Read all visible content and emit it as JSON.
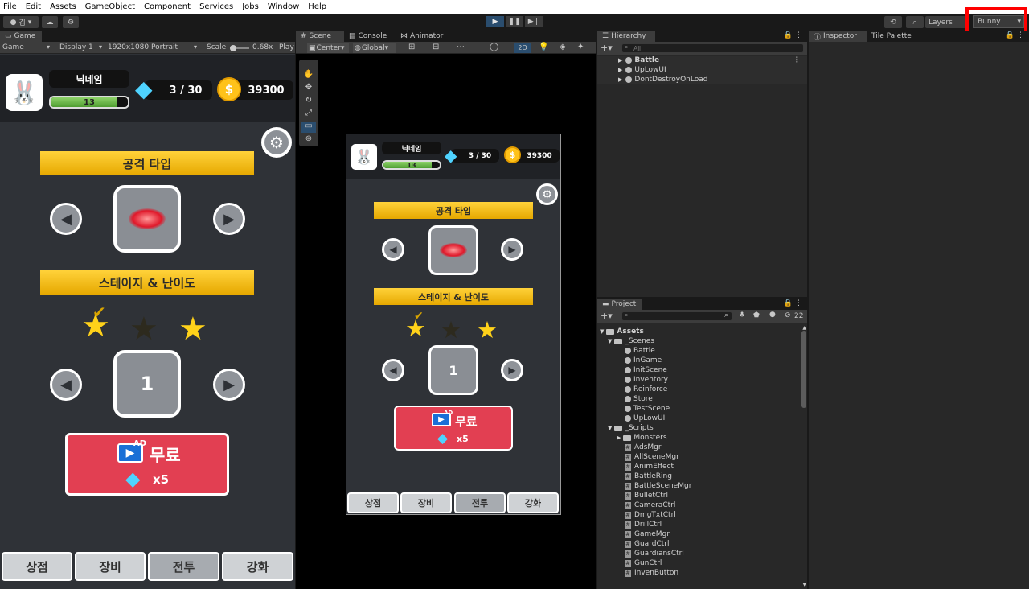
{
  "menu": [
    "File",
    "Edit",
    "Assets",
    "GameObject",
    "Component",
    "Services",
    "Jobs",
    "Window",
    "Help"
  ],
  "toolbar": {
    "account_label": "김",
    "layers_label": "Layers",
    "layout_value": "Bunny"
  },
  "game_panel": {
    "tab_label": "Game",
    "view_mode": "Game",
    "display": "Display 1",
    "resolution": "1920x1080 Portrait",
    "scale_label": "Scale",
    "scale_value": "0.68x",
    "play_label": "Play"
  },
  "scene_panel": {
    "tabs": [
      "Scene",
      "Console",
      "Animator"
    ],
    "pivot": "Center",
    "space": "Global",
    "mode_2d": "2D"
  },
  "mobile_ui": {
    "nickname": "닉네임",
    "level": "13",
    "level_progress": 0.85,
    "gems": "3 / 30",
    "gold": "39300",
    "attack_type_title": "공격 타입",
    "stage_title": "스테이지 & 난이도",
    "stage_number": "1",
    "stars": [
      "gold-checked",
      "dark",
      "gold"
    ],
    "ad_badge": "AD",
    "free_label": "무료",
    "gem_cost": "x5",
    "bottom_tabs": [
      "상점",
      "장비",
      "전투",
      "강화"
    ],
    "selected_tab": "전투"
  },
  "hierarchy": {
    "tab_label": "Hierarchy",
    "search_placeholder": "All",
    "items": [
      "Battle",
      "UpLowUI",
      "DontDestroyOnLoad"
    ]
  },
  "inspector": {
    "tabs": [
      "Inspector",
      "Tile Palette"
    ]
  },
  "project": {
    "tab_label": "Project",
    "hidden_count": "22",
    "root": "Assets",
    "scenes_folder": "_Scenes",
    "scenes": [
      "Battle",
      "InGame",
      "InitScene",
      "Inventory",
      "Reinforce",
      "Store",
      "TestScene",
      "UpLowUI"
    ],
    "scripts_folder": "_Scripts",
    "scripts_subfolder": "Monsters",
    "scripts": [
      "AdsMgr",
      "AllSceneMgr",
      "AnimEffect",
      "BattleRing",
      "BattleSceneMgr",
      "BulletCtrl",
      "CameraCtrl",
      "DmgTxtCtrl",
      "DrillCtrl",
      "GameMgr",
      "GuardCtrl",
      "GuardiansCtrl",
      "GunCtrl",
      "InvenButton"
    ]
  },
  "colors": {
    "accent_red": "#ff0000",
    "ribbon_yellow": "#ffd23a",
    "free_button_red": "#e23f52",
    "xp_green": "#6fbf4c",
    "play_blue": "#2a4d6e"
  }
}
